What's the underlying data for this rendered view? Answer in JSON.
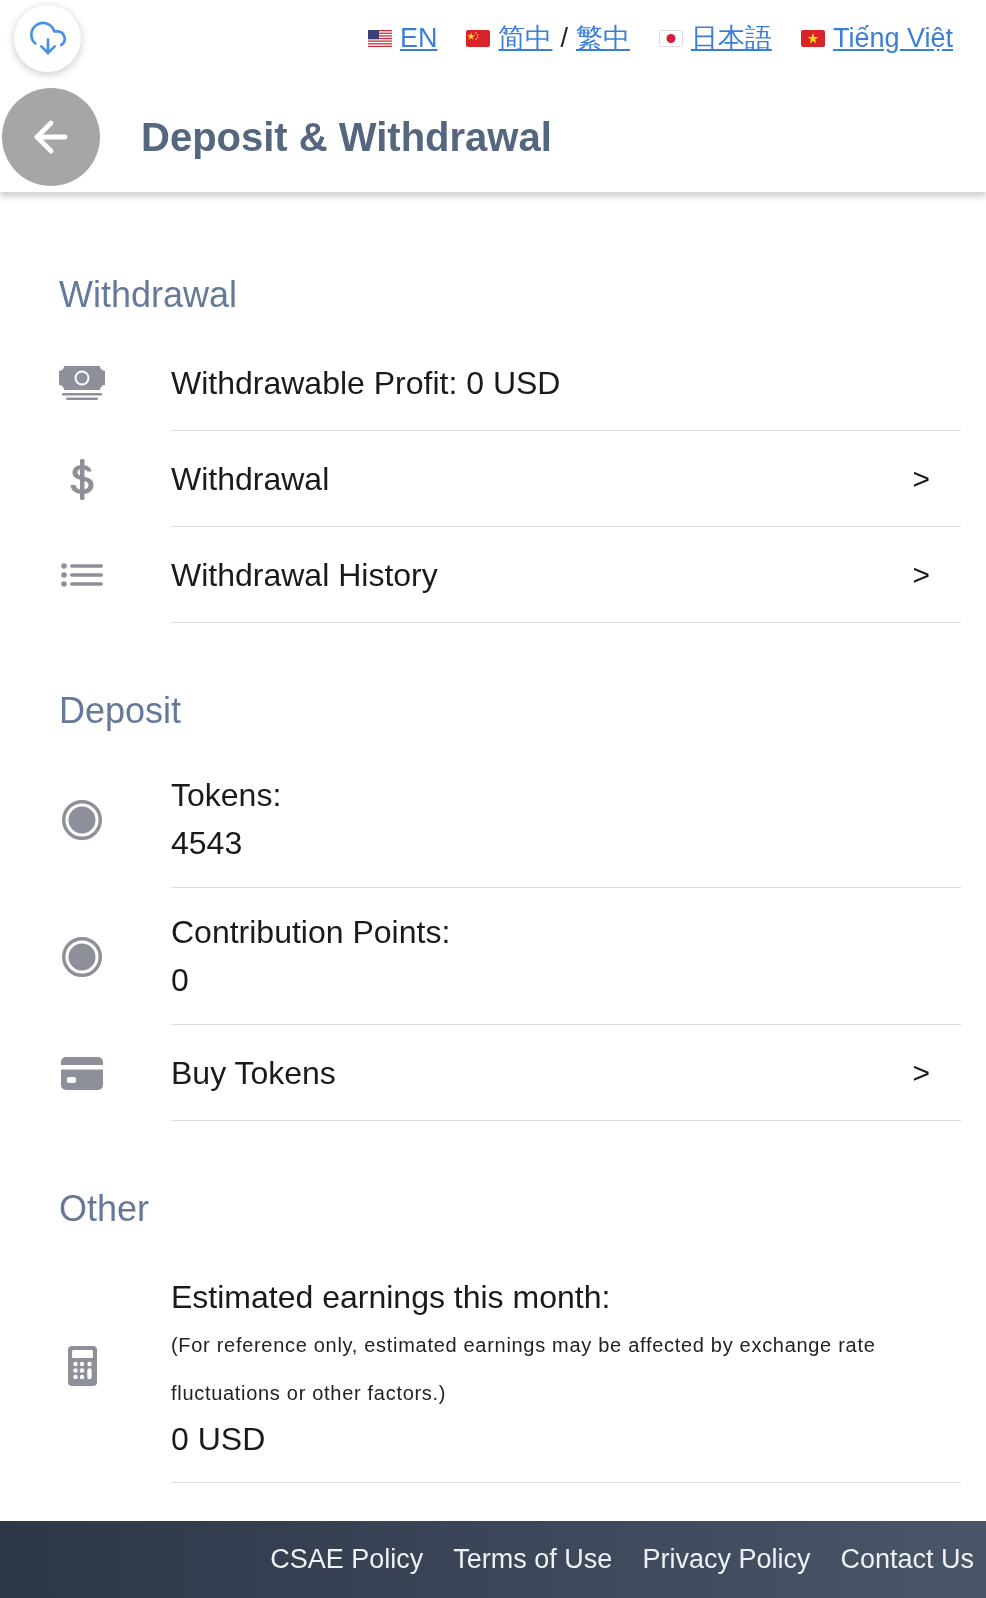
{
  "top_bar": {
    "languages": [
      {
        "links": [
          "EN"
        ]
      },
      {
        "links": [
          "简中",
          "繁中"
        ],
        "separator": "/"
      },
      {
        "links": [
          "日本語"
        ]
      },
      {
        "links": [
          "Tiếng Việt"
        ]
      }
    ]
  },
  "header": {
    "title": "Deposit & Withdrawal"
  },
  "sections": [
    {
      "title": "Withdrawal",
      "rows": [
        {
          "kind": "info",
          "label": "Withdrawable Profit: 0 USD"
        },
        {
          "kind": "link",
          "label": "Withdrawal",
          "chevron": ">"
        },
        {
          "kind": "link",
          "label": "Withdrawal History",
          "chevron": ">"
        }
      ]
    },
    {
      "title": "Deposit",
      "rows": [
        {
          "kind": "stat",
          "label": "Tokens:",
          "value": "4543"
        },
        {
          "kind": "stat",
          "label": "Contribution Points:",
          "value": "0"
        },
        {
          "kind": "link",
          "label": "Buy Tokens",
          "chevron": ">"
        }
      ]
    },
    {
      "title": "Other",
      "rows": [
        {
          "kind": "estimate",
          "label": "Estimated earnings this month:",
          "note": "(For reference only, estimated earnings may be affected by exchange rate fluctuations or other factors.)",
          "value": "0 USD"
        }
      ]
    }
  ],
  "footer": {
    "links": [
      "CSAE Policy",
      "Terms of Use",
      "Privacy Policy",
      "Contact Us"
    ]
  }
}
